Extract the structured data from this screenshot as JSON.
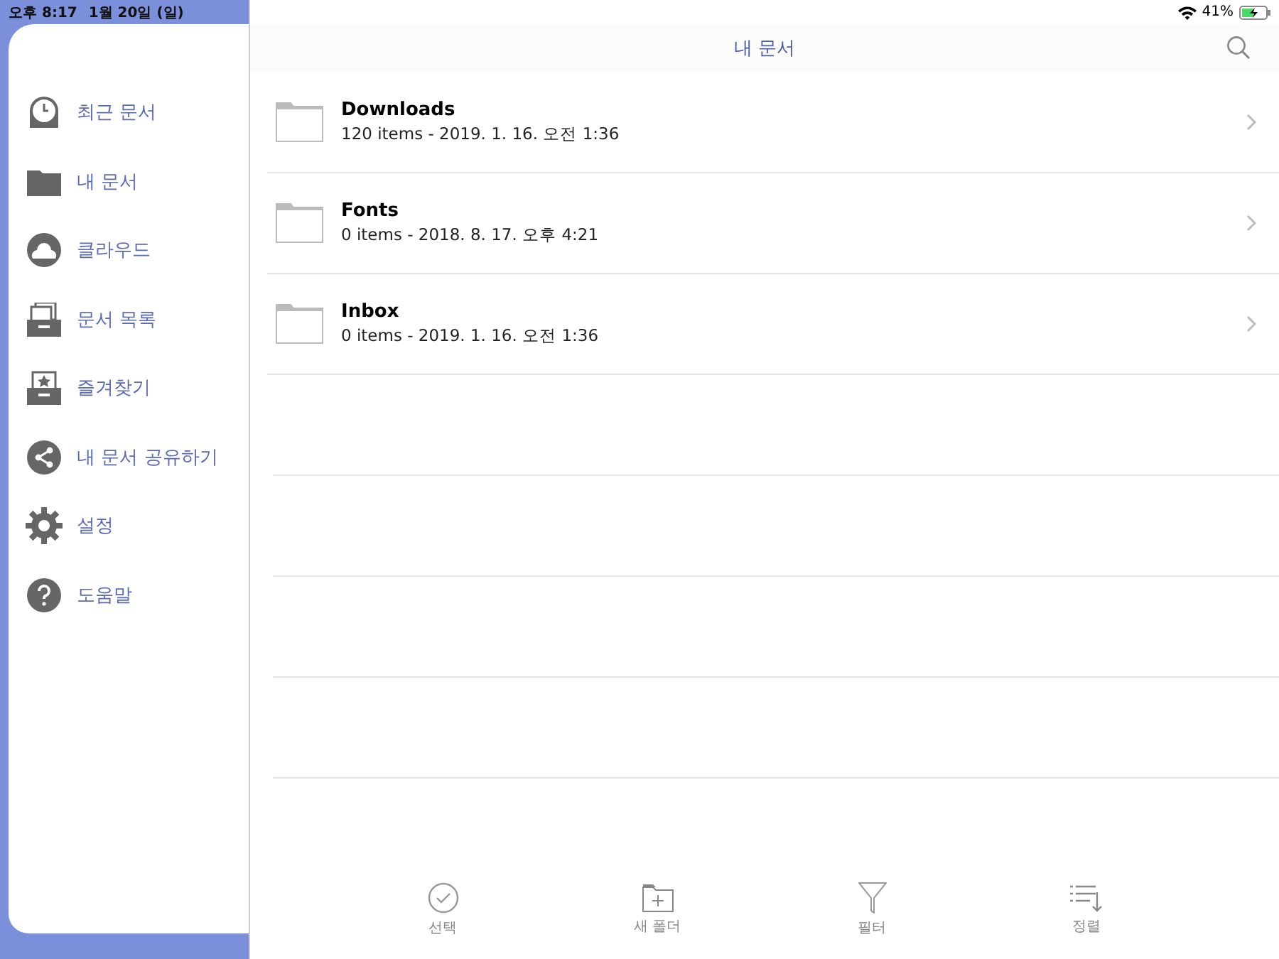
{
  "status_bar": {
    "time": "오후 8:17",
    "date": "1월 20일 (일)",
    "battery": "41%"
  },
  "sidebar": {
    "items": [
      {
        "label": "최근 문서"
      },
      {
        "label": "내 문서"
      },
      {
        "label": "클라우드"
      },
      {
        "label": "문서 목록"
      },
      {
        "label": "즐겨찾기"
      },
      {
        "label": "내 문서 공유하기"
      },
      {
        "label": "설정"
      },
      {
        "label": "도움말"
      }
    ]
  },
  "nav": {
    "title": "내 문서"
  },
  "folders": [
    {
      "name": "Downloads",
      "info": "120 items - 2019. 1. 16. 오전 1:36"
    },
    {
      "name": "Fonts",
      "info": "0 items - 2018. 8. 17. 오후 4:21"
    },
    {
      "name": "Inbox",
      "info": "0 items - 2019. 1. 16. 오전 1:36"
    }
  ],
  "toolbar": [
    {
      "label": "선택"
    },
    {
      "label": "새 폴더"
    },
    {
      "label": "필터"
    },
    {
      "label": "정렬"
    }
  ]
}
